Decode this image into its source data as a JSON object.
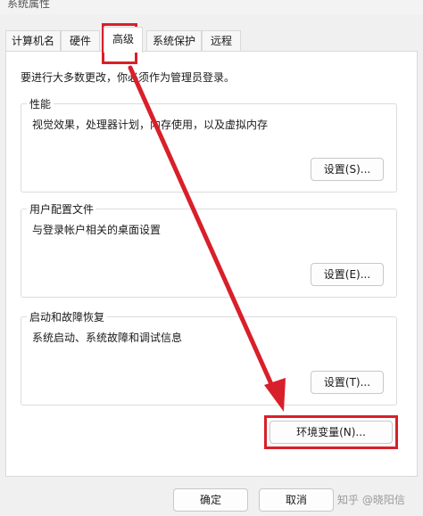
{
  "window": {
    "title": "系统属性"
  },
  "tabs": [
    {
      "label": "计算机名",
      "active": false
    },
    {
      "label": "硬件",
      "active": false
    },
    {
      "label": "高级",
      "active": true
    },
    {
      "label": "系统保护",
      "active": false
    },
    {
      "label": "远程",
      "active": false
    }
  ],
  "admin_note": "要进行大多数更改，你必须作为管理员登录。",
  "groups": {
    "performance": {
      "title": "性能",
      "description": "视觉效果，处理器计划，内存使用，以及虚拟内存",
      "button": "设置(S)..."
    },
    "user_profiles": {
      "title": "用户配置文件",
      "description": "与登录帐户相关的桌面设置",
      "button": "设置(E)..."
    },
    "startup_recovery": {
      "title": "启动和故障恢复",
      "description": "系统启动、系统故障和调试信息",
      "button": "设置(T)..."
    }
  },
  "env_button": "环境变量(N)...",
  "footer": {
    "ok": "确定",
    "cancel": "取消"
  },
  "watermark": "知乎 @晓阳信",
  "annotation": {
    "color": "#d8202a",
    "icon": "red-arrow-icon"
  }
}
